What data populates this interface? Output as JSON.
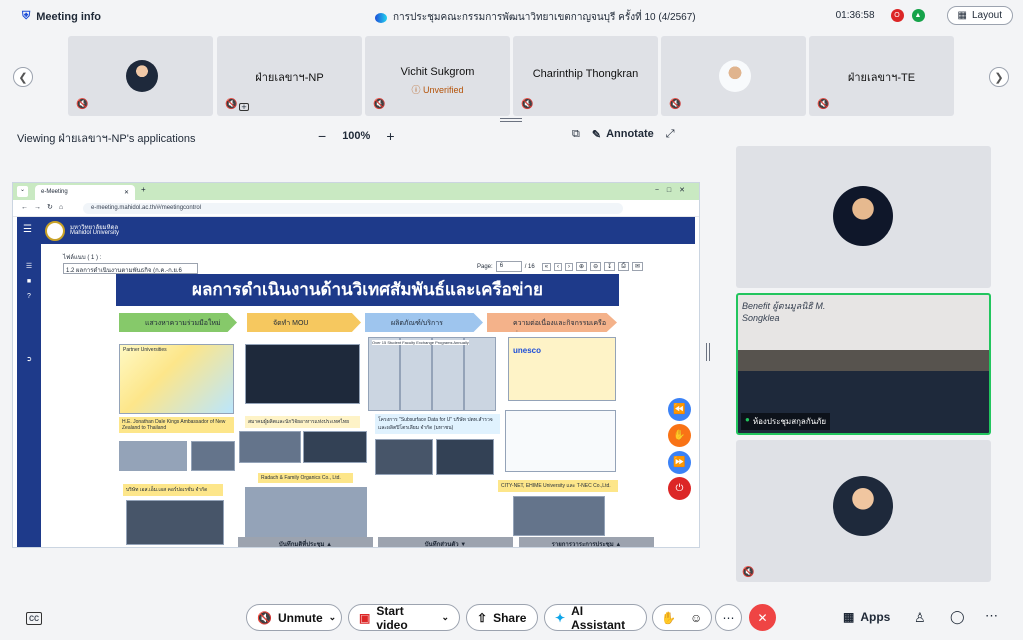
{
  "topbar": {
    "meeting_info": "Meeting info",
    "title": "การประชุมคณะกรรมการพัฒนาวิทยาเขตกาญจนบุรี ครั้งที่ 10 (4/2567)",
    "time": "01:36:58",
    "layout": "Layout"
  },
  "participants": [
    {
      "name": ""
    },
    {
      "name": "ฝ่ายเลขาฯ-NP"
    },
    {
      "name": "Vichit Sukgrom",
      "status": "Unverified"
    },
    {
      "name": "Charinthip Thongkran"
    },
    {
      "name": ""
    },
    {
      "name": "ฝ่ายเลขาฯ-TE"
    }
  ],
  "share": {
    "viewing": "Viewing ฝ่ายเลขาฯ-NP's applications",
    "zoom": "100%",
    "annotate": "Annotate"
  },
  "browser": {
    "tab": "e-Meeting",
    "url": "e-meeting.mahidol.ac.th/#/meetingcontrol"
  },
  "app": {
    "org_th": "มหาวิทยาลัยมหิดล",
    "org_en": "Mahidol University",
    "file_label": "ไฟล์แนบ ( 1 ) :",
    "file_value": "1.2 ผลการดำเนินงานตามพันธกิจ (ก.ค.-ก.ย.6",
    "page_label": "Page:",
    "page_value": "6",
    "page_total": "/ 16"
  },
  "slide": {
    "title": "ผลการดำเนินงานด้านวิเทศสัมพันธ์และเครือข่าย",
    "pills": [
      "แสวงหาความร่วมมือใหม่",
      "จัดทำ MOU",
      "ผลิตภัณฑ์/บริการ",
      "ความต่อเนื่องและกิจกรรมเครือข่าย"
    ],
    "photo_captions": {
      "partner": "Partner Universities",
      "ambassador": "H.E. Jonathan Dale Kings Ambassador of New Zealand to Thailand",
      "mou": "สมาคมผู้ผลิตและนักวิจัยอาหารแห่งประเทศไทย",
      "exchange": "Over 15 Student Faculty Exchange Programs Annually",
      "unesco": "unesco",
      "subsurface": "โครงการ \"Subsurface Data for U\" บริษัท ปตท.สำรวจและผลิตปิโตรเลียม จำกัด (มหาชน)",
      "radach": "Radach & Family Organics Co., Ltd.",
      "company": "บริษัท เอส.เอ็ม.เอส คอร์ปอเรชั่น จำกัด",
      "citynet": "CITY-NET, EHIME University และ T-NEC Co.,Ltd."
    }
  },
  "bottom_tabs": [
    "บันทึกมติที่ประชุม",
    "บันทึกส่วนตัว",
    "รายการวาระการประชุม"
  ],
  "room_label": "ห้องประชุมสกุลกันภัย",
  "room_board": "Benefit ผู้ตนมูลนิธิ M. Songklea",
  "toolbar": {
    "unmute": "Unmute",
    "start_video": "Start video",
    "share": "Share",
    "ai": "AI Assistant",
    "apps": "Apps"
  },
  "colors": {
    "accent": "#1e3a8a",
    "end": "#ef4444",
    "mic_off": "#dc2626"
  }
}
